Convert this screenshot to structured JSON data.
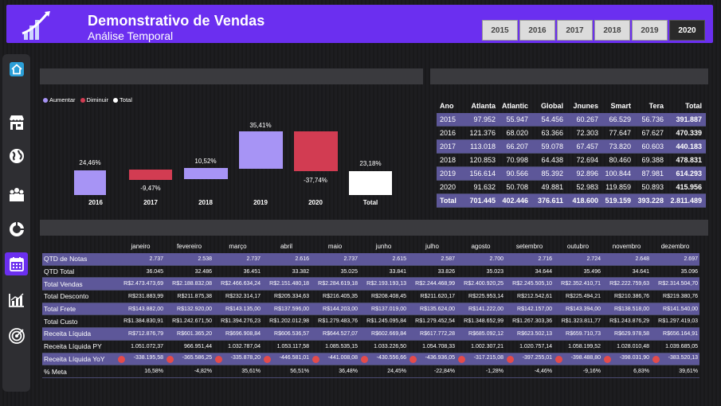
{
  "header": {
    "title": "Demonstrativo de Vendas",
    "subtitle": "Análise Temporal",
    "years": [
      "2015",
      "2016",
      "2017",
      "2018",
      "2019",
      "2020"
    ],
    "active_year": "2020",
    "color": "#6b2ff0"
  },
  "sidebar": {
    "icons": [
      "home-icon",
      "store-icon",
      "globe-icon",
      "people-icon",
      "pie-icon",
      "calendar-icon",
      "bar-chart-icon",
      "target-icon"
    ],
    "active": "calendar-icon"
  },
  "waterfall": {
    "legend": [
      {
        "label": "Aumentar",
        "color": "#a794f5"
      },
      {
        "label": "Diminuir",
        "color": "#d23c52"
      },
      {
        "label": "Total",
        "color": "#ffffff"
      }
    ],
    "categories": [
      "2016",
      "2017",
      "2018",
      "2019",
      "2020",
      "Total"
    ],
    "labels": [
      "24,46%",
      "-9,47%",
      "10,52%",
      "35,41%",
      "-37,74%",
      "23,18%"
    ]
  },
  "chart_data": {
    "type": "bar",
    "categories": [
      "2016",
      "2017",
      "2018",
      "2019",
      "2020",
      "Total"
    ],
    "values": [
      24.46,
      -9.47,
      10.52,
      35.41,
      -37.74,
      23.18
    ]
  },
  "year_table": {
    "headers": [
      "Ano",
      "Atlanta",
      "Atlantic",
      "Global",
      "Jnunes",
      "Smart",
      "Tera",
      "Total"
    ],
    "rows": [
      [
        "2015",
        "97.952",
        "55.947",
        "54.456",
        "60.267",
        "66.529",
        "56.736",
        "391.887"
      ],
      [
        "2016",
        "121.376",
        "68.020",
        "63.366",
        "72.303",
        "77.647",
        "67.627",
        "470.339"
      ],
      [
        "2017",
        "113.018",
        "66.207",
        "59.078",
        "67.457",
        "73.820",
        "60.603",
        "440.183"
      ],
      [
        "2018",
        "120.853",
        "70.998",
        "64.438",
        "72.694",
        "80.460",
        "69.388",
        "478.831"
      ],
      [
        "2019",
        "156.614",
        "90.566",
        "85.392",
        "92.896",
        "100.844",
        "87.981",
        "614.293"
      ],
      [
        "2020",
        "91.632",
        "50.708",
        "49.881",
        "52.983",
        "119.859",
        "50.893",
        "415.956"
      ],
      [
        "Total",
        "701.445",
        "402.446",
        "376.611",
        "418.600",
        "519.159",
        "393.228",
        "2.811.489"
      ]
    ]
  },
  "month_table": {
    "months": [
      "janeiro",
      "fevereiro",
      "março",
      "abril",
      "maio",
      "junho",
      "julho",
      "agosto",
      "setembro",
      "outubro",
      "novembro",
      "dezembro"
    ],
    "rows": [
      {
        "label": "QTD de Notas",
        "values": [
          "2.737",
          "2.538",
          "2.737",
          "2.616",
          "2.737",
          "2.615",
          "2.587",
          "2.700",
          "2.716",
          "2.724",
          "2.648",
          "2.697"
        ]
      },
      {
        "label": "QTD Total",
        "values": [
          "36.045",
          "32.486",
          "36.451",
          "33.382",
          "35.025",
          "33.841",
          "33.826",
          "35.023",
          "34.644",
          "35.496",
          "34.641",
          "35.096"
        ]
      },
      {
        "label": "Total Vendas",
        "values": [
          "R$2.473.473,69",
          "R$2.188.832,08",
          "R$2.466.634,24",
          "R$2.151.480,18",
          "R$2.284.619,18",
          "R$2.193.193,13",
          "R$2.244.468,99",
          "R$2.400.920,25",
          "R$2.245.505,10",
          "R$2.352.410,71",
          "R$2.222.759,63",
          "R$2.314.504,70"
        ]
      },
      {
        "label": "Total Desconto",
        "values": [
          "R$231.883,99",
          "R$211.875,38",
          "R$232.314,17",
          "R$205.334,63",
          "R$216.405,35",
          "R$208.408,45",
          "R$211.620,17",
          "R$225.953,14",
          "R$212.542,61",
          "R$225.494,21",
          "R$210.386,76",
          "R$219.380,76"
        ]
      },
      {
        "label": "Total Frete",
        "values": [
          "R$143.882,00",
          "R$132.920,00",
          "R$143.135,00",
          "R$137.596,00",
          "R$144.203,00",
          "R$137.019,00",
          "R$135.624,00",
          "R$141.222,00",
          "R$142.157,00",
          "R$143.394,00",
          "R$138.518,00",
          "R$141.540,00"
        ]
      },
      {
        "label": "Total Custo",
        "values": [
          "R$1.384.830,91",
          "R$1.242.671,50",
          "R$1.394.276,23",
          "R$1.202.012,98",
          "R$1.279.483,76",
          "R$1.245.095,84",
          "R$1.279.452,54",
          "R$1.348.652,99",
          "R$1.267.303,36",
          "R$1.323.811,77",
          "R$1.243.876,29",
          "R$1.297.419,03"
        ]
      },
      {
        "label": "Receita Líquida",
        "values": [
          "R$712.876,79",
          "R$601.365,20",
          "R$696.908,84",
          "R$606.536,57",
          "R$644.527,07",
          "R$602.669,84",
          "R$617.772,28",
          "R$685.092,12",
          "R$623.502,13",
          "R$659.710,73",
          "R$629.978,58",
          "R$656.164,91"
        ]
      },
      {
        "label": "Receita Líquida PY",
        "values": [
          "1.051.072,37",
          "966.951,44",
          "1.032.787,04",
          "1.053.117,58",
          "1.085.535,15",
          "1.033.226,50",
          "1.054.708,33",
          "1.002.307,21",
          "1.020.757,14",
          "1.058.199,52",
          "1.028.010,48",
          "1.039.685,05"
        ]
      },
      {
        "label": "Receita Líquida YoY",
        "values": [
          "-338.195,58",
          "-365.586,25",
          "-335.878,20",
          "-446.581,01",
          "-441.008,08",
          "-430.556,66",
          "-436.936,05",
          "-317.215,08",
          "-397.255,01",
          "-398.488,80",
          "-398.031,90",
          "-383.520,13"
        ]
      },
      {
        "label": "% Meta",
        "values": [
          "16,58%",
          "-4,82%",
          "35,61%",
          "56,51%",
          "36,48%",
          "24,45%",
          "-22,84%",
          "-1,28%",
          "-4,46%",
          "-9,16%",
          "6,83%",
          "39,61%"
        ]
      }
    ]
  }
}
